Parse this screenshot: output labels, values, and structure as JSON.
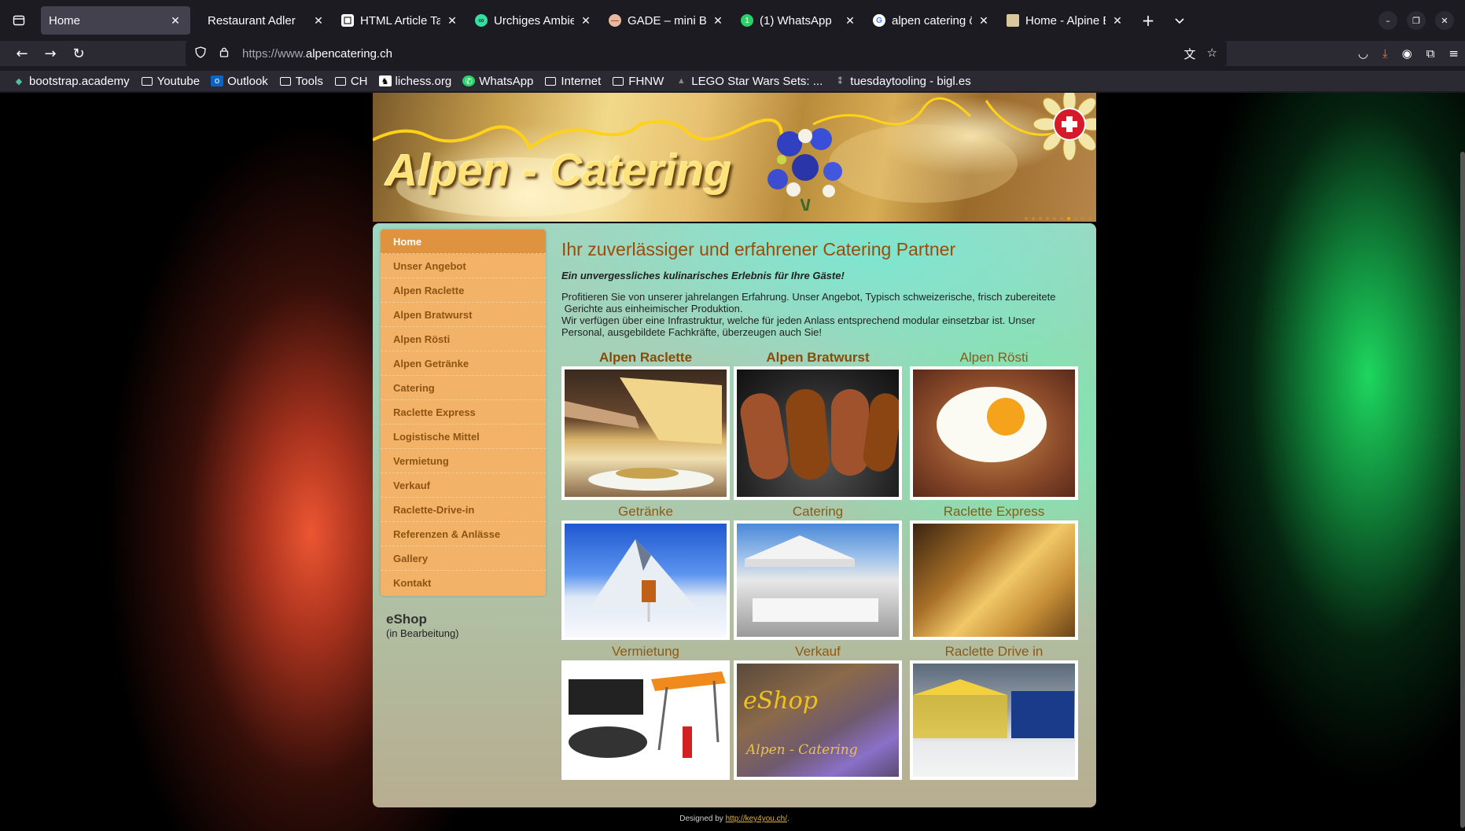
{
  "browser": {
    "tabs": [
      {
        "title": "Home",
        "active": true,
        "icon": "tab-list-icon"
      },
      {
        "title": "Restaurant Adler",
        "active": false,
        "icon": "none"
      },
      {
        "title": "HTML Article Tag Usa",
        "active": false,
        "icon": "page-icon"
      },
      {
        "title": "Urchiges Ambiente m",
        "active": false,
        "icon": "tripadvisor-icon"
      },
      {
        "title": "GADE – mini Beiz",
        "active": false,
        "icon": "gade-icon"
      },
      {
        "title": "(1) WhatsApp",
        "active": false,
        "icon": "whatsapp-icon"
      },
      {
        "title": "alpen catering österr",
        "active": false,
        "icon": "google-icon"
      },
      {
        "title": "Home - Alpine Eleme",
        "active": false,
        "icon": "site-icon"
      }
    ],
    "url": {
      "prefix": "https://www.",
      "domain": "alpencatering.ch"
    },
    "bookmarks": [
      {
        "label": "bootstrap.academy",
        "icon": "bootstrap-icon"
      },
      {
        "label": "Youtube",
        "icon": "folder-icon"
      },
      {
        "label": "Outlook",
        "icon": "outlook-icon"
      },
      {
        "label": "Tools",
        "icon": "folder-icon"
      },
      {
        "label": "CH",
        "icon": "folder-icon"
      },
      {
        "label": "lichess.org",
        "icon": "lichess-icon"
      },
      {
        "label": "WhatsApp",
        "icon": "whatsapp-icon"
      },
      {
        "label": "Internet",
        "icon": "folder-icon"
      },
      {
        "label": "FHNW",
        "icon": "folder-icon"
      },
      {
        "label": "LEGO Star Wars Sets: ...",
        "icon": "lego-icon"
      },
      {
        "label": "tuesdaytooling - bigl.es",
        "icon": "page-icon"
      }
    ]
  },
  "site": {
    "banner_title": "Alpen - Catering",
    "menu": [
      "Home",
      "Unser Angebot",
      "Alpen Raclette",
      "Alpen Bratwurst",
      "Alpen Rösti",
      "Alpen Getränke",
      "Catering",
      "Raclette Express",
      "Logistische Mittel",
      "Vermietung",
      "Verkauf",
      "Raclette-Drive-in",
      "Referenzen & Anlässe",
      "Gallery",
      "Kontakt"
    ],
    "eshop": {
      "title": "eShop",
      "subtitle": "(in Bearbeitung)"
    },
    "heading": "Ihr zuverlässiger und erfahrener Catering Partner",
    "lead": "Ein unvergessliches kulinarisches Erlebnis für Ihre Gäste!",
    "para1_line1": "Profitieren Sie von unserer jahrelangen Erfahrung. Unser Angebot, Typisch schweizerische, frisch zubereitete",
    "para1_line2": " Gerichte aus einheimischer Produktion.",
    "para2": "Wir verfügen über eine Infrastruktur, welche für jeden Anlass entsprechend modular einsetzbar ist. Unser Personal, ausgebildete Fachkräfte, überzeugen auch Sie!",
    "tiles": [
      {
        "label": "Alpen Raclette",
        "bold": true
      },
      {
        "label": "Alpen Bratwurst",
        "bold": true
      },
      {
        "label": "Alpen Rösti",
        "bold": false
      },
      {
        "label": "Getränke",
        "bold": false
      },
      {
        "label": "Catering",
        "bold": false
      },
      {
        "label": "Raclette Express",
        "bold": false
      },
      {
        "label": "Vermietung",
        "bold": false
      },
      {
        "label": "Verkauf",
        "bold": false
      },
      {
        "label": "Raclette Drive in",
        "bold": false
      }
    ],
    "eshop_image_text": "eShop",
    "eshop_image_subtext": "Alpen - Catering",
    "footer_prefix": "Designed by ",
    "footer_link": "http://key4you.ch/",
    "footer_suffix": "."
  }
}
